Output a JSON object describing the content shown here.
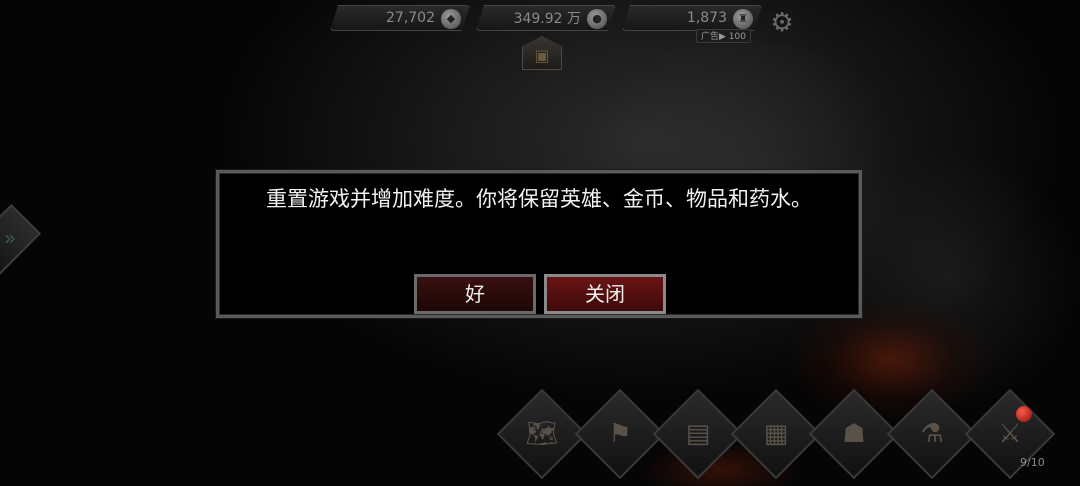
{
  "resources": [
    {
      "value": "27,702",
      "icon": "gem-pile-icon"
    },
    {
      "value": "349.92 万",
      "icon": "coin-pile-icon"
    },
    {
      "value": "1,873",
      "icon": "trophy-icon"
    }
  ],
  "ad_badge": {
    "label": "广告▶ 100"
  },
  "dialog": {
    "message": "重置游戏并增加难度。你将保留英雄、金币、物品和药水。",
    "ok_label": "好",
    "close_label": "关闭"
  },
  "bottom_bar": {
    "slots": [
      {
        "name": "map-icon"
      },
      {
        "name": "forge-icon"
      },
      {
        "name": "scroll-icon"
      },
      {
        "name": "anvil-icon"
      },
      {
        "name": "bestiary-icon"
      },
      {
        "name": "potions-icon"
      },
      {
        "name": "battle-icon"
      }
    ],
    "battle_count": "9/10"
  },
  "colors": {
    "accent_red": "#6a1414",
    "border_grey": "#5a5a5a"
  }
}
